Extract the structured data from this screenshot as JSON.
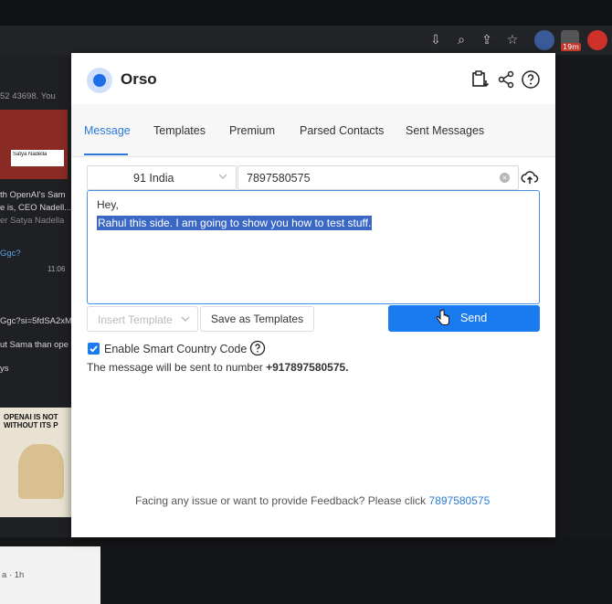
{
  "browser": {
    "extension_timer": "19m"
  },
  "background": {
    "line1": "52 43698. You",
    "thumb_caption1": "Satya Nadella",
    "line2": "th OpenAI's Sam",
    "line3": "e is, CEO Nadell...",
    "line4": "er Satya Nadella",
    "line5": "Ggc?",
    "time1": "11:06",
    "line6": "Ggc?si=5fdSA2xMU",
    "line7": "ut Sama than ope",
    "line8": "ys",
    "meme_text": "OPENAI IS NOT WITHOUT ITS P",
    "bottom_text": "a · 1h"
  },
  "popup": {
    "title": "Orso",
    "tabs": [
      {
        "label": "Message",
        "active": true
      },
      {
        "label": "Templates",
        "active": false
      },
      {
        "label": "Premium",
        "active": false
      },
      {
        "label": "Parsed Contacts",
        "active": false
      },
      {
        "label": "Sent Messages",
        "active": false
      }
    ],
    "country_select": {
      "value": "91 India"
    },
    "phone_input": {
      "value": "7897580575"
    },
    "message": {
      "line1": "Hey,",
      "line2_selected": "Rahul this side. I am going to show you how to test stuff."
    },
    "insert_template": {
      "placeholder": "Insert Template"
    },
    "save_template_label": "Save as Templates",
    "send_label": "Send",
    "smart_country": {
      "label": "Enable Smart Country Code",
      "checked": true
    },
    "info": {
      "prefix": "The message will be sent to number",
      "number": "+917897580575."
    },
    "footer": {
      "text": "Facing any issue or want to provide Feedback? Please click",
      "link": "7897580575"
    }
  },
  "colors": {
    "accent": "#1a7bf0",
    "selection": "#3b68c4",
    "tab_active": "#2a7bd6"
  }
}
